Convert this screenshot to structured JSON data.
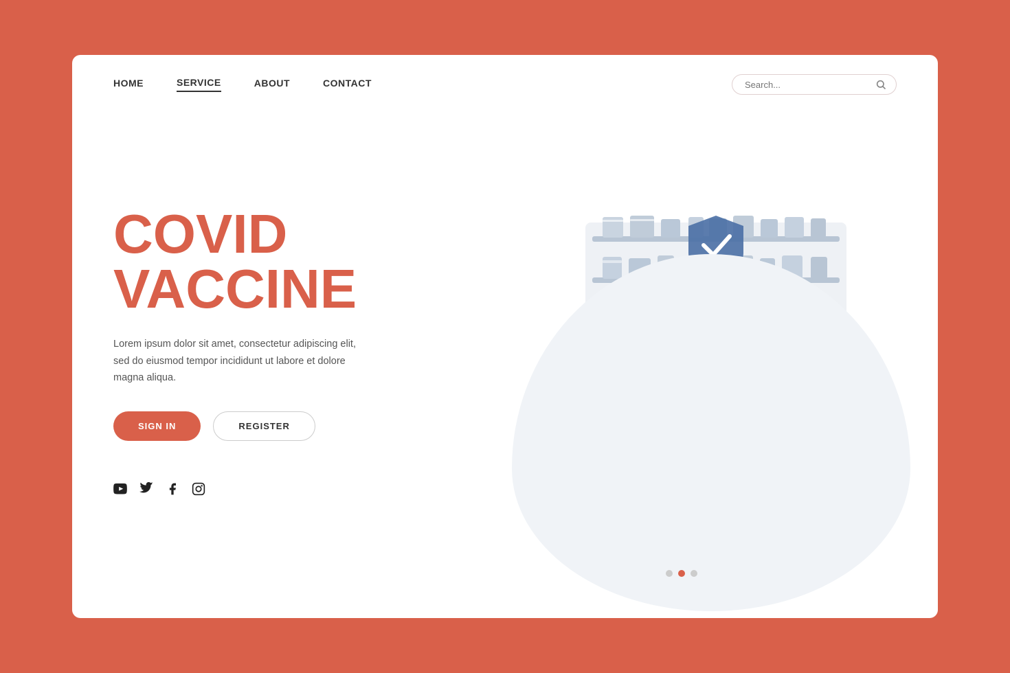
{
  "page": {
    "bg_color": "#d9604a"
  },
  "navbar": {
    "links": [
      {
        "label": "HOME",
        "active": false
      },
      {
        "label": "SERVICE",
        "active": true
      },
      {
        "label": "ABOUT",
        "active": false
      },
      {
        "label": "CONTACT",
        "active": false
      }
    ],
    "search_placeholder": "Search..."
  },
  "hero": {
    "title_line1": "COVID",
    "title_line2": "VACCINE",
    "description": "Lorem ipsum dolor sit amet, consectetur adipiscing elit, sed do eiusmod tempor incididunt ut labore et dolore magna aliqua.",
    "btn_signin": "SIGN IN",
    "btn_register": "REGISTER"
  },
  "social": {
    "icons": [
      "youtube",
      "twitter",
      "facebook",
      "instagram"
    ]
  },
  "slides": {
    "total": 3,
    "active": 1
  }
}
